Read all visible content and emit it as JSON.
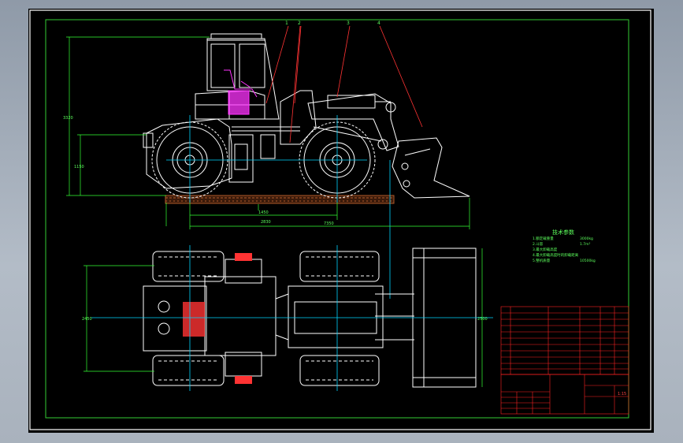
{
  "drawing": {
    "colors": {
      "frame": "#ffffff",
      "inner_border": "#33cc33",
      "machine": "#ffffff",
      "centerline": "#00d5ff",
      "dimension": "#33ff33",
      "leader": "#ff3333",
      "seat": "#ff33ff",
      "ground": "#b05a2a",
      "title_block": "#ff2222"
    },
    "spec_title": "技术参数",
    "spec_lines": [
      "1.额定载重量",
      "2.斗容",
      "3.最大卸载高度",
      "4.最大卸载高度时的卸载距离",
      "5.整机质量"
    ],
    "spec_values": [
      "3000kg",
      "1.7m³",
      "",
      "",
      "10500kg"
    ],
    "part_labels": [
      "1",
      "2",
      "3",
      "4"
    ],
    "scale": "1:15"
  }
}
